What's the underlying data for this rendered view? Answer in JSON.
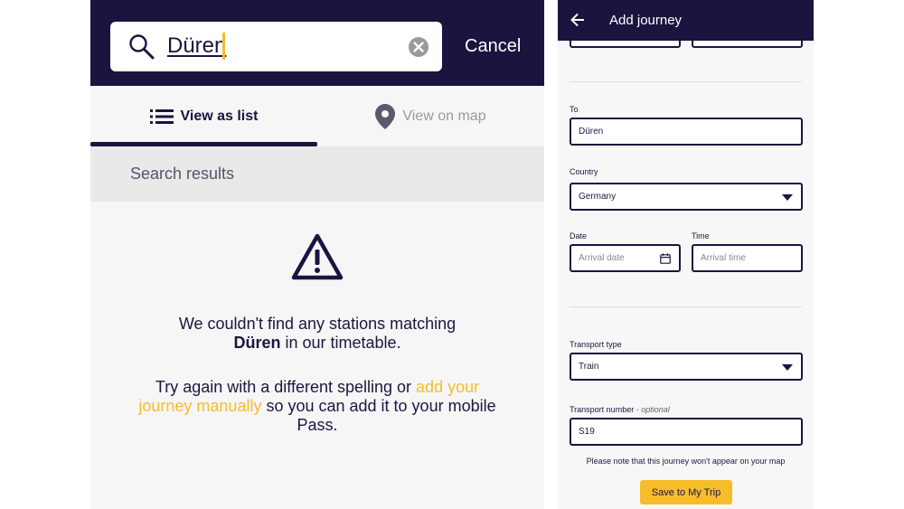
{
  "search_screen": {
    "search": {
      "value": "Düren"
    },
    "cancel_label": "Cancel",
    "tabs": [
      {
        "label": "View as list",
        "icon": "list-icon",
        "active": true
      },
      {
        "label": "View on map",
        "icon": "map-pin-icon",
        "active": false
      }
    ],
    "results_title": "Search results",
    "empty_state": {
      "icon": "warning-icon",
      "line1_prefix": "We couldn't find any stations matching",
      "line1_term": "Düren",
      "line1_suffix": " in our timetable.",
      "line2_prefix": "Try again with a different spelling or ",
      "line2_link": "add your journey manually",
      "line2_suffix": " so you can add it to your mobile Pass."
    }
  },
  "add_journey_screen": {
    "title": "Add journey",
    "back_icon": "arrow-left-icon",
    "to": {
      "label": "To",
      "value": "Düren"
    },
    "country": {
      "label": "Country",
      "value": "Germany"
    },
    "date": {
      "label": "Date",
      "placeholder": "Arrival date",
      "icon": "calendar-icon"
    },
    "time": {
      "label": "Time",
      "placeholder": "Arrival time"
    },
    "transport_type": {
      "label": "Transport type",
      "value": "Train"
    },
    "transport_number": {
      "label": "Transport number",
      "optional": "- optional",
      "value": "S19"
    },
    "note": "Please note that this journey won't appear on your map",
    "save_label": "Save to My Trip"
  },
  "colors": {
    "brand_navy": "#19153f",
    "accent_yellow": "#f6bd2a",
    "background": "#f6f6f6"
  }
}
